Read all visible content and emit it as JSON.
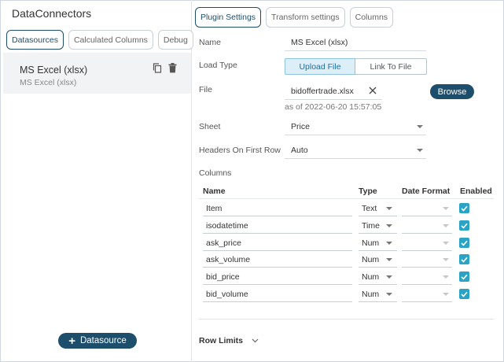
{
  "app": {
    "title": "DataConnectors"
  },
  "left_tabs": [
    {
      "label": "Datasources",
      "active": true
    },
    {
      "label": "Calculated Columns",
      "active": false
    },
    {
      "label": "Debug",
      "active": false
    }
  ],
  "datasource": {
    "name": "MS Excel (xlsx)",
    "subtitle": "MS Excel (xlsx)",
    "icons": [
      "copy-icon",
      "trash-icon"
    ]
  },
  "add_button": {
    "label": "Datasource",
    "icon": "plus-icon"
  },
  "right_tabs": [
    {
      "label": "Plugin Settings",
      "active": true
    },
    {
      "label": "Transform settings",
      "active": false
    },
    {
      "label": "Columns",
      "active": false
    }
  ],
  "form": {
    "name_label": "Name",
    "name_value": "MS Excel (xlsx)",
    "load_type_label": "Load Type",
    "load_type_options": [
      "Upload File",
      "Link To File"
    ],
    "load_type_selected": "Upload File",
    "file_label": "File",
    "file_name": "bidoffertrade.xlsx",
    "file_timestamp": "as of 2022-06-20 15:57:05",
    "browse_label": "Browse",
    "sheet_label": "Sheet",
    "sheet_value": "Price",
    "headers_label": "Headers On First Row",
    "headers_value": "Auto",
    "columns_label": "Columns"
  },
  "columns_table": {
    "headers": [
      "Name",
      "Type",
      "Date Format",
      "Enabled"
    ],
    "rows": [
      {
        "name": "Item",
        "type": "Text",
        "date_format": "",
        "enabled": true
      },
      {
        "name": "isodatetime",
        "type": "Time",
        "date_format": "",
        "enabled": true
      },
      {
        "name": "ask_price",
        "type": "Num",
        "date_format": "",
        "enabled": true
      },
      {
        "name": "ask_volume",
        "type": "Num",
        "date_format": "",
        "enabled": true
      },
      {
        "name": "bid_price",
        "type": "Num",
        "date_format": "",
        "enabled": true
      },
      {
        "name": "bid_volume",
        "type": "Num",
        "date_format": "",
        "enabled": true
      }
    ]
  },
  "row_limits": {
    "label": "Row Limits"
  },
  "colors": {
    "primary": "#1d4e6b",
    "check": "#2aa3c4",
    "toggle_on": "#dceef8"
  }
}
